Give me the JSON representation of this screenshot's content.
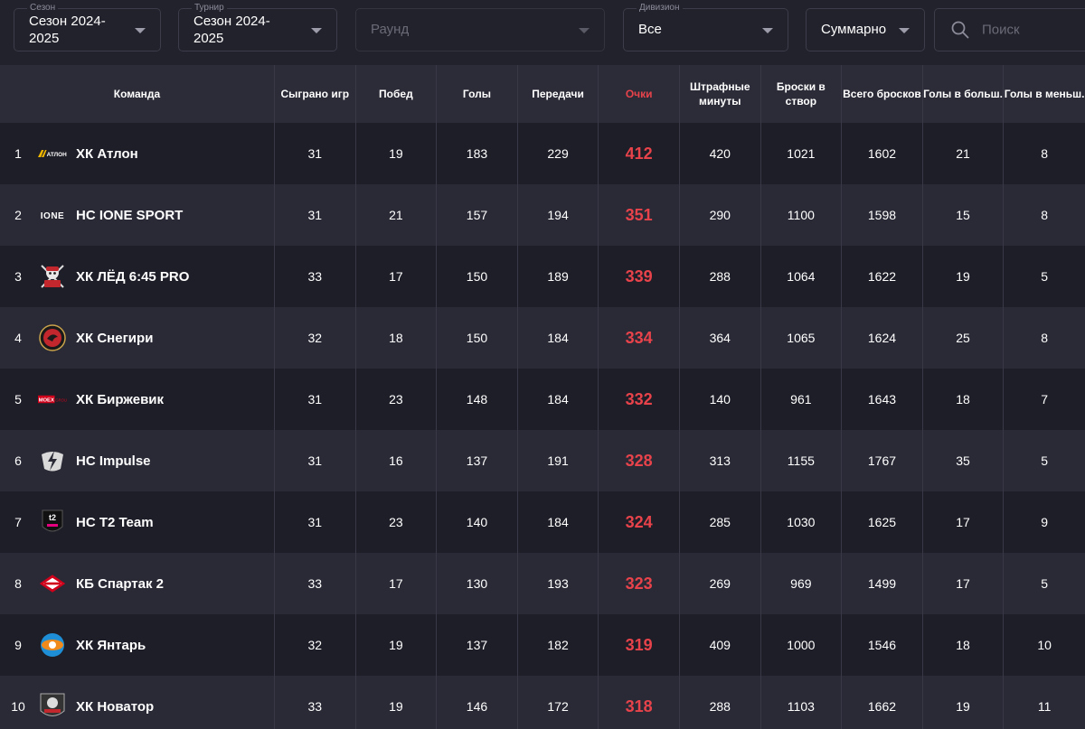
{
  "filters": {
    "season": {
      "label": "Сезон",
      "value": "Сезон 2024-\n2025"
    },
    "tournament": {
      "label": "Турнир",
      "value": "Сезон 2024-\n2025"
    },
    "round": {
      "placeholder": "Раунд"
    },
    "division": {
      "label": "Дивизион",
      "value": "Все"
    },
    "mode": {
      "value": "Суммарно"
    },
    "search": {
      "placeholder": "Поиск",
      "icon": "search-icon"
    }
  },
  "columns": [
    "Команда",
    "Сыграно игр",
    "Побед",
    "Голы",
    "Передачи",
    "Очки",
    "Штрафные минуты",
    "Броски в створ",
    "Всего бросков",
    "Голы в больш.",
    "Голы в меньш."
  ],
  "colors": {
    "accent": "#e8434b",
    "row_dark": "#1e1e28",
    "row_light": "#2a2a37",
    "header": "#2c2c38"
  },
  "rows": [
    {
      "rank": "1",
      "team": "ХК Атлон",
      "logo": "atlon-logo",
      "games": "31",
      "wins": "19",
      "goals": "183",
      "assists": "229",
      "points": "412",
      "pim": "420",
      "sog": "1021",
      "shots": "1602",
      "ppg": "21",
      "shg": "8"
    },
    {
      "rank": "2",
      "team": "НС IONE SPORT",
      "logo": "ione-logo",
      "games": "31",
      "wins": "21",
      "goals": "157",
      "assists": "194",
      "points": "351",
      "pim": "290",
      "sog": "1100",
      "shots": "1598",
      "ppg": "15",
      "shg": "8"
    },
    {
      "rank": "3",
      "team": "ХК ЛЁД 6:45 PRO",
      "logo": "led-logo",
      "games": "33",
      "wins": "17",
      "goals": "150",
      "assists": "189",
      "points": "339",
      "pim": "288",
      "sog": "1064",
      "shots": "1622",
      "ppg": "19",
      "shg": "5"
    },
    {
      "rank": "4",
      "team": "ХК Снегири",
      "logo": "snegiri-logo",
      "games": "32",
      "wins": "18",
      "goals": "150",
      "assists": "184",
      "points": "334",
      "pim": "364",
      "sog": "1065",
      "shots": "1624",
      "ppg": "25",
      "shg": "8"
    },
    {
      "rank": "5",
      "team": "ХК Биржевик",
      "logo": "moex-logo",
      "games": "31",
      "wins": "23",
      "goals": "148",
      "assists": "184",
      "points": "332",
      "pim": "140",
      "sog": "961",
      "shots": "1643",
      "ppg": "18",
      "shg": "7"
    },
    {
      "rank": "6",
      "team": "НС Impulse",
      "logo": "impulse-logo",
      "games": "31",
      "wins": "16",
      "goals": "137",
      "assists": "191",
      "points": "328",
      "pim": "313",
      "sog": "1155",
      "shots": "1767",
      "ppg": "35",
      "shg": "5"
    },
    {
      "rank": "7",
      "team": "НС Т2 Team",
      "logo": "t2-logo",
      "games": "31",
      "wins": "23",
      "goals": "140",
      "assists": "184",
      "points": "324",
      "pim": "285",
      "sog": "1030",
      "shots": "1625",
      "ppg": "17",
      "shg": "9"
    },
    {
      "rank": "8",
      "team": "КБ Спартак 2",
      "logo": "spartak-logo",
      "games": "33",
      "wins": "17",
      "goals": "130",
      "assists": "193",
      "points": "323",
      "pim": "269",
      "sog": "969",
      "shots": "1499",
      "ppg": "17",
      "shg": "5"
    },
    {
      "rank": "9",
      "team": "ХК Янтарь",
      "logo": "yantar-logo",
      "games": "32",
      "wins": "19",
      "goals": "137",
      "assists": "182",
      "points": "319",
      "pim": "409",
      "sog": "1000",
      "shots": "1546",
      "ppg": "18",
      "shg": "10"
    },
    {
      "rank": "10",
      "team": "ХК Новатор",
      "logo": "novator-logo",
      "games": "33",
      "wins": "19",
      "goals": "146",
      "assists": "172",
      "points": "318",
      "pim": "288",
      "sog": "1103",
      "shots": "1662",
      "ppg": "19",
      "shg": "11"
    }
  ],
  "logo_text": {
    "atlon": "АТЛОН",
    "ione": "IONE",
    "moex": "MOEX",
    "moex_sub": "GROUP",
    "t2": "t2"
  }
}
